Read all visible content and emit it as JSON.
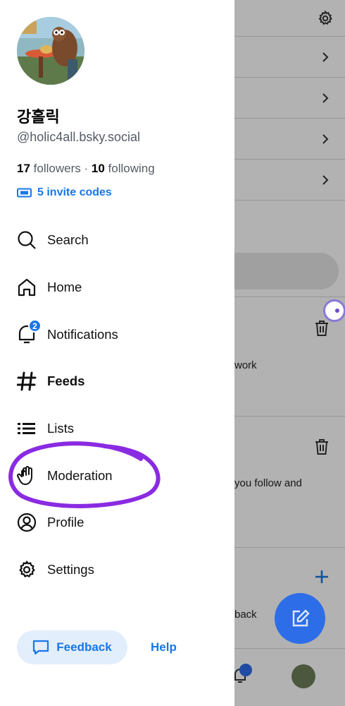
{
  "profile": {
    "display_name": "강홀릭",
    "handle": "@holic4all.bsky.social",
    "followers_count": "17",
    "followers_label": "followers",
    "separator": " · ",
    "following_count": "10",
    "following_label": "following",
    "invite_codes": "5 invite codes"
  },
  "nav": {
    "items": [
      {
        "label": "Search",
        "icon": "search-icon"
      },
      {
        "label": "Home",
        "icon": "home-icon"
      },
      {
        "label": "Notifications",
        "icon": "bell-icon",
        "badge": "2"
      },
      {
        "label": "Feeds",
        "icon": "hash-icon",
        "active": true
      },
      {
        "label": "Lists",
        "icon": "list-icon"
      },
      {
        "label": "Moderation",
        "icon": "hand-icon"
      },
      {
        "label": "Profile",
        "icon": "profile-icon"
      },
      {
        "label": "Settings",
        "icon": "gear-icon"
      }
    ]
  },
  "footer": {
    "feedback_label": "Feedback",
    "help_label": "Help"
  },
  "background": {
    "text_1": "work",
    "text_2": "you follow and",
    "text_3": "back",
    "tab_badge": "2"
  },
  "colors": {
    "accent": "#1877e8",
    "annotation": "#8a2be2",
    "fab": "#2d6ee8"
  }
}
